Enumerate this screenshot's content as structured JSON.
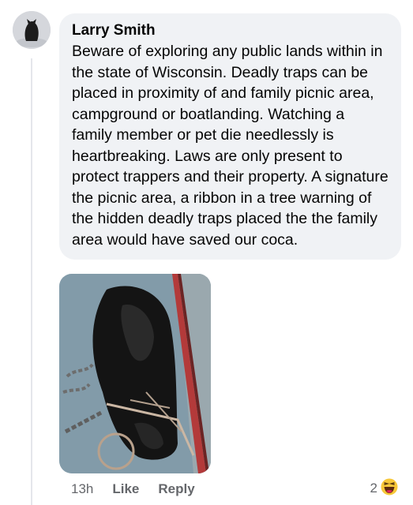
{
  "comment": {
    "author": "Larry Smith",
    "text": "Beware of exploring any public lands within in the state of Wisconsin. Deadly traps can be placed in proximity of and family picnic area, campground or boatlanding. Watching a family member or pet die needlessly is heartbreaking. Laws are only present to protect trappers and their property. A signature the picnic area, a ribbon in a tree warning of the hidden deadly traps placed the the family area would have saved our coca.",
    "attachment_icon": "photo-of-dog-in-trap"
  },
  "actions": {
    "timestamp": "13h",
    "like_label": "Like",
    "reply_label": "Reply"
  },
  "reactions": {
    "count": "2",
    "icon": "haha-emoji-icon"
  },
  "colors": {
    "bubble": "#f0f2f5",
    "text": "#050505",
    "secondary_text": "#65676b",
    "reaction_yellow": "#f7c83a",
    "reaction_red": "#e0245e"
  }
}
